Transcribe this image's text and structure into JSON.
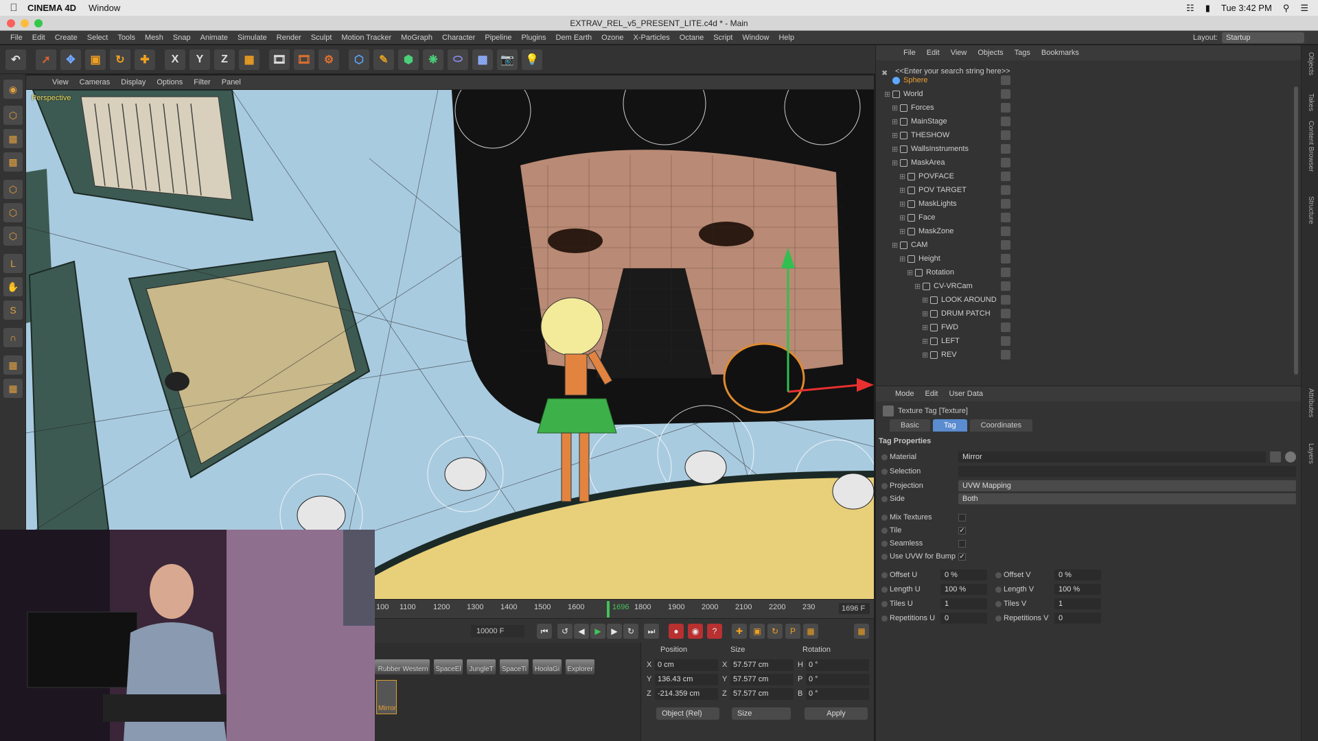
{
  "macbar": {
    "app": "CINEMA 4D",
    "window_menu": "Window",
    "clock": "Tue 3:42 PM"
  },
  "window": {
    "title": "EXTRAV_REL_v5_PRESENT_LITE.c4d * - Main"
  },
  "menu": [
    "File",
    "Edit",
    "Create",
    "Select",
    "Tools",
    "Mesh",
    "Snap",
    "Animate",
    "Simulate",
    "Render",
    "Sculpt",
    "Motion Tracker",
    "MoGraph",
    "Character",
    "Pipeline",
    "Plugins",
    "Dem Earth",
    "Ozone",
    "X-Particles",
    "Octane",
    "Script",
    "Window",
    "Help"
  ],
  "layout": {
    "label": "Layout:",
    "value": "Startup"
  },
  "viewport": {
    "menu": [
      "View",
      "Cameras",
      "Display",
      "Options",
      "Filter",
      "Panel"
    ],
    "label": "Perspective"
  },
  "timeline": {
    "ticks": [
      "1100",
      "1200",
      "1300",
      "1400",
      "1500",
      "1600",
      "1800",
      "1900",
      "2000",
      "2100",
      "2200",
      "230"
    ],
    "first_tick": "100",
    "current": "1696",
    "current_field": "1696 F",
    "end_field": "10000 F"
  },
  "materials": {
    "items": [
      "Rubber",
      "Western",
      "SpaceEl",
      "JungleT",
      "SpaceTi",
      "HoolaGi",
      "Explorer"
    ],
    "selected": "Mirror"
  },
  "coords": {
    "headers": {
      "position": "Position",
      "size": "Size",
      "rotation": "Rotation"
    },
    "rows": [
      {
        "axis": "X",
        "pos": "0 cm",
        "size_axis": "X",
        "size": "57.577 cm",
        "rot_axis": "H",
        "rot": "0 °"
      },
      {
        "axis": "Y",
        "pos": "136.43 cm",
        "size_axis": "Y",
        "size": "57.577 cm",
        "rot_axis": "P",
        "rot": "0 °"
      },
      {
        "axis": "Z",
        "pos": "-214.359 cm",
        "size_axis": "Z",
        "size": "57.577 cm",
        "rot_axis": "B",
        "rot": "0 °"
      }
    ],
    "mode": "Object (Rel)",
    "size_mode": "Size",
    "apply": "Apply"
  },
  "object_manager": {
    "menu": [
      "File",
      "Edit",
      "View",
      "Objects",
      "Tags",
      "Bookmarks"
    ],
    "search_placeholder": "<<Enter your search string here>>",
    "objects": [
      {
        "name": "Sphere",
        "indent": 0,
        "selected": true
      },
      {
        "name": "World",
        "indent": 0
      },
      {
        "name": "Forces",
        "indent": 1
      },
      {
        "name": "MainStage",
        "indent": 1
      },
      {
        "name": "THESHOW",
        "indent": 1
      },
      {
        "name": "WallsInstruments",
        "indent": 1
      },
      {
        "name": "MaskArea",
        "indent": 1
      },
      {
        "name": "POVFACE",
        "indent": 2
      },
      {
        "name": "POV TARGET",
        "indent": 2
      },
      {
        "name": "MaskLights",
        "indent": 2
      },
      {
        "name": "Face",
        "indent": 2
      },
      {
        "name": "MaskZone",
        "indent": 2
      },
      {
        "name": "CAM",
        "indent": 1
      },
      {
        "name": "Height",
        "indent": 2
      },
      {
        "name": "Rotation",
        "indent": 3
      },
      {
        "name": "CV-VRCam",
        "indent": 4
      },
      {
        "name": "LOOK AROUND",
        "indent": 5
      },
      {
        "name": "DRUM PATCH",
        "indent": 5
      },
      {
        "name": "FWD",
        "indent": 5
      },
      {
        "name": "LEFT",
        "indent": 5
      },
      {
        "name": "REV",
        "indent": 5
      }
    ]
  },
  "attributes": {
    "menu": [
      "Mode",
      "Edit",
      "User Data"
    ],
    "title": "Texture Tag [Texture]",
    "tabs": [
      "Basic",
      "Tag",
      "Coordinates"
    ],
    "active_tab": "Tag",
    "section": "Tag Properties",
    "material_label": "Material",
    "material_value": "Mirror",
    "selection_label": "Selection",
    "projection_label": "Projection",
    "projection_value": "UVW Mapping",
    "side_label": "Side",
    "side_value": "Both",
    "mix_label": "Mix Textures",
    "tile_label": "Tile",
    "seamless_label": "Seamless",
    "uvwbump_label": "Use UVW for Bump",
    "offset_u": {
      "label": "Offset U",
      "value": "0 %"
    },
    "offset_v": {
      "label": "Offset V",
      "value": "0 %"
    },
    "length_u": {
      "label": "Length U",
      "value": "100 %"
    },
    "length_v": {
      "label": "Length V",
      "value": "100 %"
    },
    "tiles_u": {
      "label": "Tiles U",
      "value": "1"
    },
    "tiles_v": {
      "label": "Tiles V",
      "value": "1"
    },
    "rep_u": {
      "label": "Repetitions U",
      "value": "0"
    },
    "rep_v": {
      "label": "Repetitions V",
      "value": "0"
    }
  },
  "side_tabs": [
    "Objects",
    "Takes",
    "Content Browser",
    "Structure",
    "Attributes",
    "Layers"
  ]
}
